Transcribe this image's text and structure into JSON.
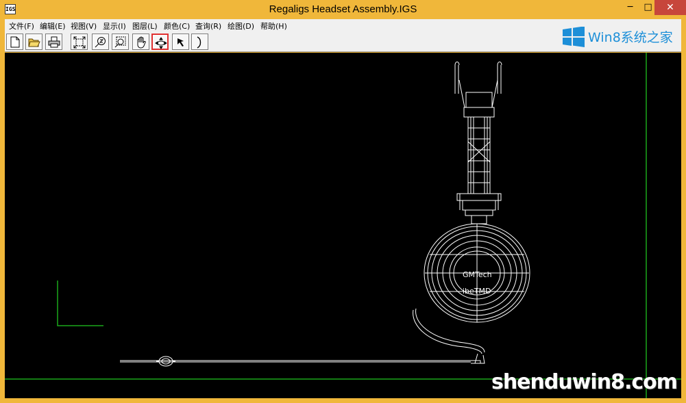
{
  "window": {
    "title": "Regaligs Headset Assembly.IGS",
    "app_icon": "IGS",
    "minimize": "─",
    "maximize": "□",
    "close": "✕"
  },
  "menu": [
    {
      "label": "文件(F)"
    },
    {
      "label": "编辑(E)"
    },
    {
      "label": "视图(V)"
    },
    {
      "label": "显示(I)"
    },
    {
      "label": "图层(L)"
    },
    {
      "label": "颜色(C)"
    },
    {
      "label": "查询(R)"
    },
    {
      "label": "绘图(D)"
    },
    {
      "label": "帮助(H)"
    }
  ],
  "toolbar": {
    "buttons": [
      {
        "icon": "new-file-icon"
      },
      {
        "icon": "open-folder-icon"
      },
      {
        "icon": "print-icon"
      },
      {
        "icon": "zoom-extents-icon"
      },
      {
        "icon": "zoom-realtime-icon"
      },
      {
        "icon": "zoom-window-icon"
      },
      {
        "icon": "pan-hand-icon"
      },
      {
        "icon": "rotate-3d-icon",
        "highlighted": true
      },
      {
        "icon": "select-arrow-icon"
      },
      {
        "icon": "arc-icon"
      }
    ]
  },
  "branding": {
    "logo_text": "Win8系统之家",
    "watermark": "shenduwin8.com"
  },
  "drawing": {
    "label_top": "GMTech",
    "label_bottom": "ibeTMD",
    "axis_color": "#1aa81a",
    "line_color": "#ffffff"
  }
}
